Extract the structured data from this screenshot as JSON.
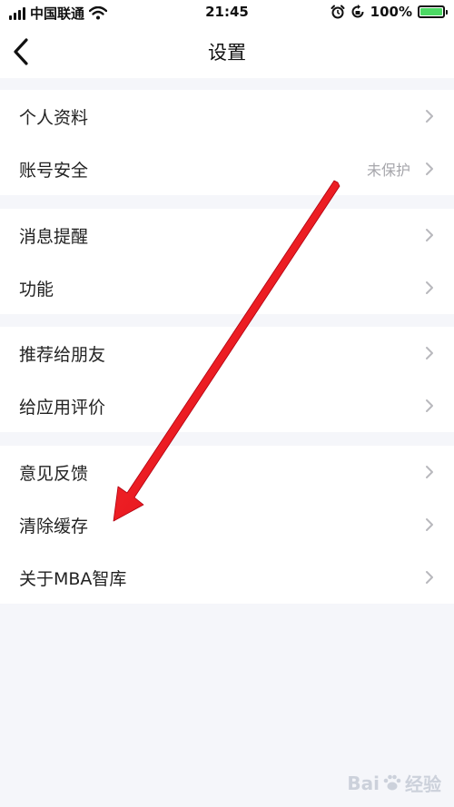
{
  "status_bar": {
    "carrier": "中国联通",
    "time": "21:45",
    "battery": "100%"
  },
  "nav": {
    "title": "设置"
  },
  "groups": [
    {
      "items": [
        {
          "label": "个人资料",
          "value": ""
        },
        {
          "label": "账号安全",
          "value": "未保护"
        }
      ]
    },
    {
      "items": [
        {
          "label": "消息提醒",
          "value": ""
        },
        {
          "label": "功能",
          "value": ""
        }
      ]
    },
    {
      "items": [
        {
          "label": "推荐给朋友",
          "value": ""
        },
        {
          "label": "给应用评价",
          "value": ""
        }
      ]
    },
    {
      "items": [
        {
          "label": "意见反馈",
          "value": ""
        },
        {
          "label": "清除缓存",
          "value": ""
        },
        {
          "label": "关于MBA智库",
          "value": ""
        }
      ]
    }
  ],
  "watermark": {
    "text_left": "Bai",
    "text_right": "经验"
  },
  "colors": {
    "background": "#f5f6fa",
    "arrow": "#e8141b",
    "battery": "#4cd964"
  }
}
